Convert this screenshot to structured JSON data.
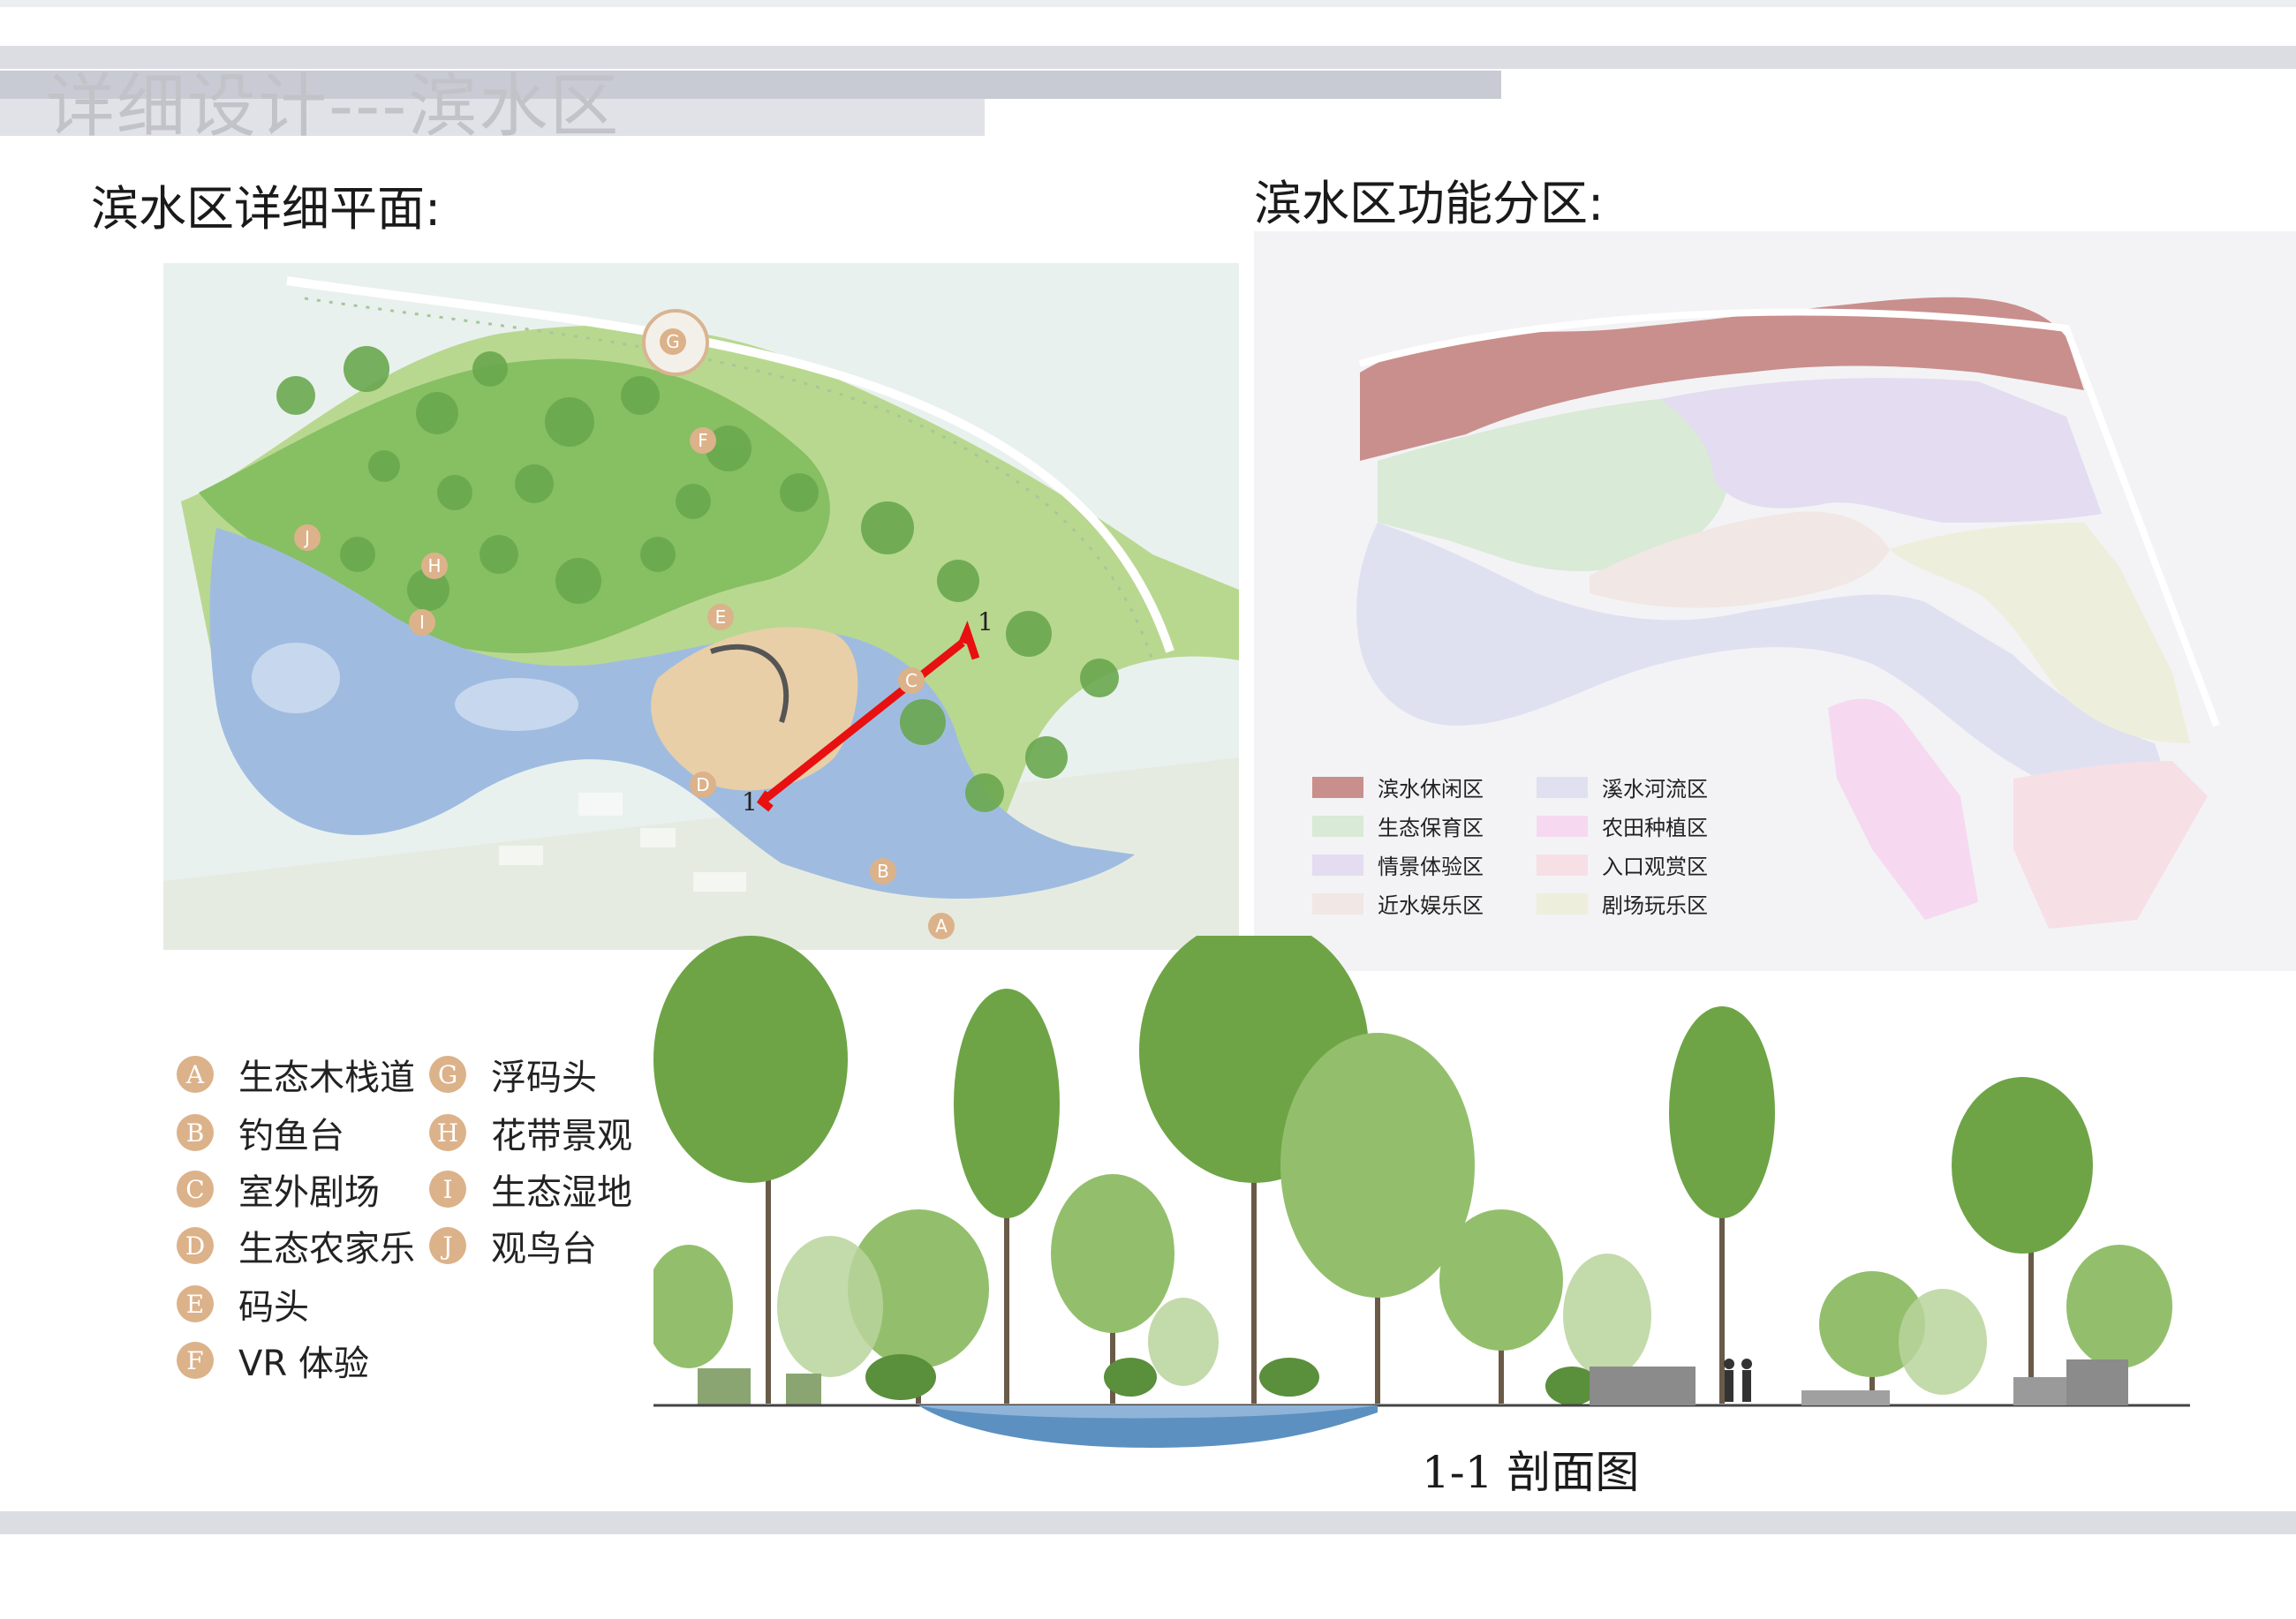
{
  "page_title": "详细设计---滨水区",
  "plan_heading": "滨水区详细平面:",
  "zoning_heading": "滨水区功能分区:",
  "section_label": "1-1 剖面图",
  "section_marker": "1",
  "plan_markers": [
    "A",
    "B",
    "C",
    "D",
    "E",
    "F",
    "G",
    "H",
    "I",
    "J"
  ],
  "legend": [
    {
      "key": "A",
      "label": "生态木栈道"
    },
    {
      "key": "B",
      "label": "钓鱼台"
    },
    {
      "key": "C",
      "label": "室外剧场"
    },
    {
      "key": "D",
      "label": "生态农家乐"
    },
    {
      "key": "E",
      "label": "码头"
    },
    {
      "key": "F",
      "label": "VR 体验"
    },
    {
      "key": "G",
      "label": "浮码头"
    },
    {
      "key": "H",
      "label": "花带景观"
    },
    {
      "key": "I",
      "label": "生态湿地"
    },
    {
      "key": "J",
      "label": "观鸟台"
    }
  ],
  "zones": [
    {
      "label": "滨水休闲区",
      "color": "#c98f8c"
    },
    {
      "label": "生态保育区",
      "color": "#d9ead6"
    },
    {
      "label": "情景体验区",
      "color": "#e4dcf0"
    },
    {
      "label": "近水娱乐区",
      "color": "#f1e7e4"
    },
    {
      "label": "溪水河流区",
      "color": "#dfe1f1"
    },
    {
      "label": "农田种植区",
      "color": "#f6d9f0"
    },
    {
      "label": "入口观赏区",
      "color": "#f7dfe6"
    },
    {
      "label": "剧场玩乐区",
      "color": "#eeeedc"
    }
  ],
  "colors": {
    "water": "#9fbce0",
    "green": "#7cb45a",
    "badge": "#dcb28a",
    "cut_line": "#e81010"
  }
}
